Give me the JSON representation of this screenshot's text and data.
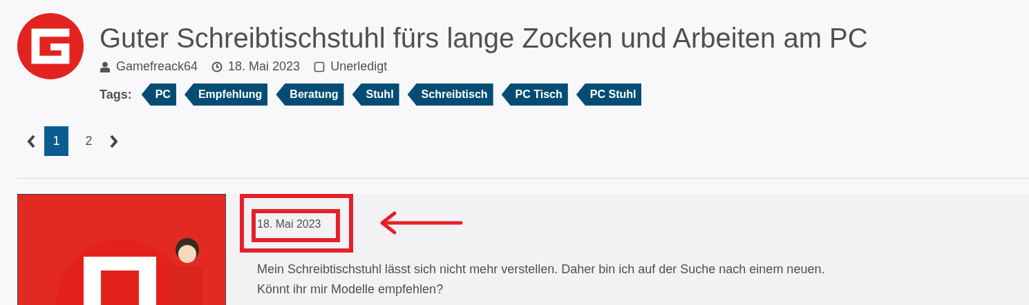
{
  "thread": {
    "title": "Guter Schreibtischstuhl fürs lange Zocken und Arbeiten am PC",
    "author": "Gamefreack64",
    "date": "18. Mai 2023",
    "status": "Unerledigt"
  },
  "tags": {
    "label": "Tags:",
    "items": [
      "PC",
      "Empfehlung",
      "Beratung",
      "Stuhl",
      "Schreibtisch",
      "PC Tisch",
      "PC Stuhl"
    ]
  },
  "pagination": {
    "pages": [
      {
        "label": "1",
        "selected": true
      },
      {
        "label": "2",
        "selected": false
      }
    ]
  },
  "post": {
    "date": "18. Mai 2023",
    "text": "Mein Schreibtischstuhl lässt sich nicht mehr verstellen. Daher bin ich auf der Suche nach einem neuen.\nKönnt ihr mir Modelle empfehlen?"
  }
}
